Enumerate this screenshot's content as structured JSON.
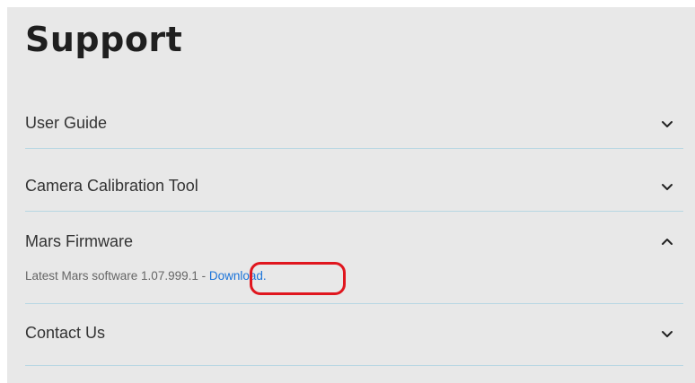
{
  "page": {
    "title": "Support"
  },
  "accordion": {
    "items": [
      {
        "label": "User Guide",
        "icon": "chevron-down-icon",
        "expanded": false
      },
      {
        "label": "Camera Calibration Tool",
        "icon": "chevron-down-icon",
        "expanded": false
      },
      {
        "label": "Mars Firmware",
        "icon": "chevron-up-icon",
        "expanded": true
      },
      {
        "label": "Contact Us",
        "icon": "chevron-down-icon",
        "expanded": false
      }
    ],
    "firmware_detail": {
      "text": "Latest Mars software 1.07.999.1",
      "separator": " - ",
      "link_label": "Download."
    }
  },
  "colors": {
    "background": "#e8e8e8",
    "divider": "#b8d7e3",
    "link": "#1a73d9",
    "highlight": "#e0161e"
  }
}
